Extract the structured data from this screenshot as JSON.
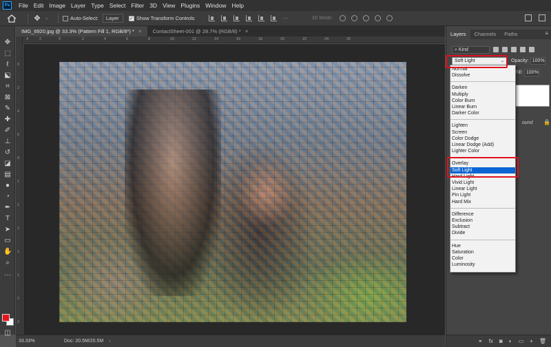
{
  "menubar": {
    "logo": "Ps",
    "items": [
      "File",
      "Edit",
      "Image",
      "Layer",
      "Type",
      "Select",
      "Filter",
      "3D",
      "View",
      "Plugins",
      "Window",
      "Help"
    ]
  },
  "options": {
    "auto_select_label": "Auto-Select:",
    "auto_select_value": "Layer",
    "show_transform_label": "Show Transform Controls",
    "three_d_label": "3D Mode:"
  },
  "tabs": [
    {
      "label": "IMG_6920.jpg @ 33.3% (Pattern Fill 1, RGB/8*) *",
      "close": "×"
    },
    {
      "label": "ContactSheet-001 @ 28.7% (RGB/8) *",
      "close": "×"
    }
  ],
  "ruler": {
    "top": [
      "4",
      "2",
      "0",
      "2",
      "4",
      "6",
      "8",
      "10",
      "12",
      "14",
      "16",
      "18",
      "20",
      "22",
      "24",
      "26"
    ],
    "left": [
      "0",
      "2",
      "4",
      "6",
      "8",
      "1",
      "1",
      "1",
      "1",
      "1",
      "2",
      "2"
    ]
  },
  "status": {
    "zoom": "33.33%",
    "doc": "Doc: 20.5M/20.5M",
    "chevron": "›"
  },
  "panel": {
    "tabs": [
      "Layers",
      "Channels",
      "Paths"
    ],
    "menu": "≡",
    "kind_label": "Kind",
    "blend_mode": "Soft Light",
    "opacity_label": "Opacity:",
    "opacity_value": "100%",
    "fill_label": "Fill:",
    "fill_value": "100%",
    "bg_label": "ound",
    "bottom_icons": [
      "⚭",
      "fx",
      "◙",
      "◐",
      "▭",
      "+",
      "🗑"
    ]
  },
  "blend_modes": [
    {
      "label": "Normal",
      "selected": false
    },
    {
      "label": "Dissolve",
      "selected": false
    },
    {
      "sep": true
    },
    {
      "label": "Darken",
      "selected": false
    },
    {
      "label": "Multiply",
      "selected": false
    },
    {
      "label": "Color Burn",
      "selected": false
    },
    {
      "label": "Linear Burn",
      "selected": false
    },
    {
      "label": "Darker Color",
      "selected": false
    },
    {
      "sep": true
    },
    {
      "label": "Lighten",
      "selected": false
    },
    {
      "label": "Screen",
      "selected": false
    },
    {
      "label": "Color Dodge",
      "selected": false
    },
    {
      "label": "Linear Dodge (Add)",
      "selected": false
    },
    {
      "label": "Lighter Color",
      "selected": false
    },
    {
      "sep": true
    },
    {
      "label": "Overlay",
      "selected": false
    },
    {
      "label": "Soft Light",
      "selected": true
    },
    {
      "label": "Hard Light",
      "selected": false
    },
    {
      "label": "Vivid Light",
      "selected": false
    },
    {
      "label": "Linear Light",
      "selected": false
    },
    {
      "label": "Pin Light",
      "selected": false
    },
    {
      "label": "Hard Mix",
      "selected": false
    },
    {
      "sep": true
    },
    {
      "label": "Difference",
      "selected": false
    },
    {
      "label": "Exclusion",
      "selected": false
    },
    {
      "label": "Subtract",
      "selected": false
    },
    {
      "label": "Divide",
      "selected": false
    },
    {
      "sep": true
    },
    {
      "label": "Hue",
      "selected": false
    },
    {
      "label": "Saturation",
      "selected": false
    },
    {
      "label": "Color",
      "selected": false
    },
    {
      "label": "Luminosity",
      "selected": false
    }
  ],
  "tools": [
    "move-tool",
    "marquee-tool",
    "lasso-tool",
    "object-select-tool",
    "crop-tool",
    "frame-tool",
    "eyedropper-tool",
    "healing-brush-tool",
    "brush-tool",
    "clone-stamp-tool",
    "history-brush-tool",
    "eraser-tool",
    "gradient-tool",
    "blur-tool",
    "dodge-tool",
    "pen-tool",
    "type-tool",
    "path-select-tool",
    "rectangle-tool",
    "hand-tool",
    "zoom-tool",
    "more-tools"
  ],
  "colors": {
    "foreground": "#e8141c",
    "background": "#ffffff",
    "highlight": "#e0101e",
    "selection": "#0a64d2"
  }
}
